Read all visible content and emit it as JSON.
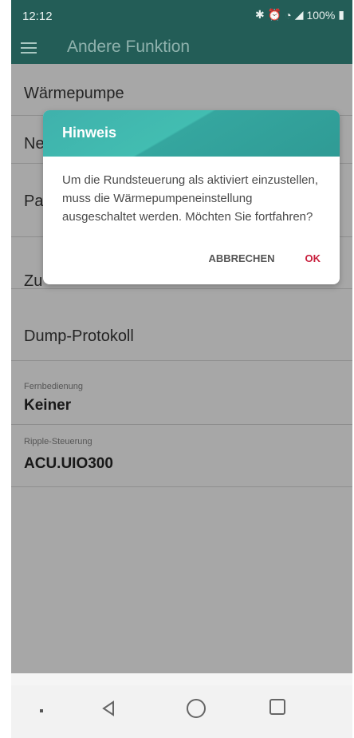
{
  "status_bar": {
    "time": "12:12",
    "battery": "100%"
  },
  "toolbar": {
    "title": "Andere Funktion"
  },
  "list": {
    "item_1": "Wärmepumpe",
    "item_2_partial": "Ne",
    "item_3_partial": "Pa",
    "item_4_partial": "Zu",
    "item_5": "Dump-Protokoll",
    "remote_label": "Fernbedienung",
    "remote_value": "Keiner",
    "ripple_label": "Ripple-Steuerung",
    "ripple_value": "ACU.UIO300"
  },
  "dialog": {
    "title": "Hinweis",
    "message": "Um die Rundsteuerung als aktiviert einzustellen, muss die Wärmepumpeneinstellung ausgeschaltet werden. Möchten Sie fortfahren?",
    "cancel_label": "ABBRECHEN",
    "ok_label": "OK"
  },
  "colors": {
    "app_bar": "#235d57",
    "dialog_header": "#42bdb1",
    "ok_text": "#c81e3c"
  },
  "icons": [
    "menu-icon",
    "bluetooth-icon",
    "alarm-icon",
    "wifi-icon",
    "signal-icon",
    "battery-icon",
    "back-icon",
    "home-icon",
    "recent-apps-icon"
  ]
}
